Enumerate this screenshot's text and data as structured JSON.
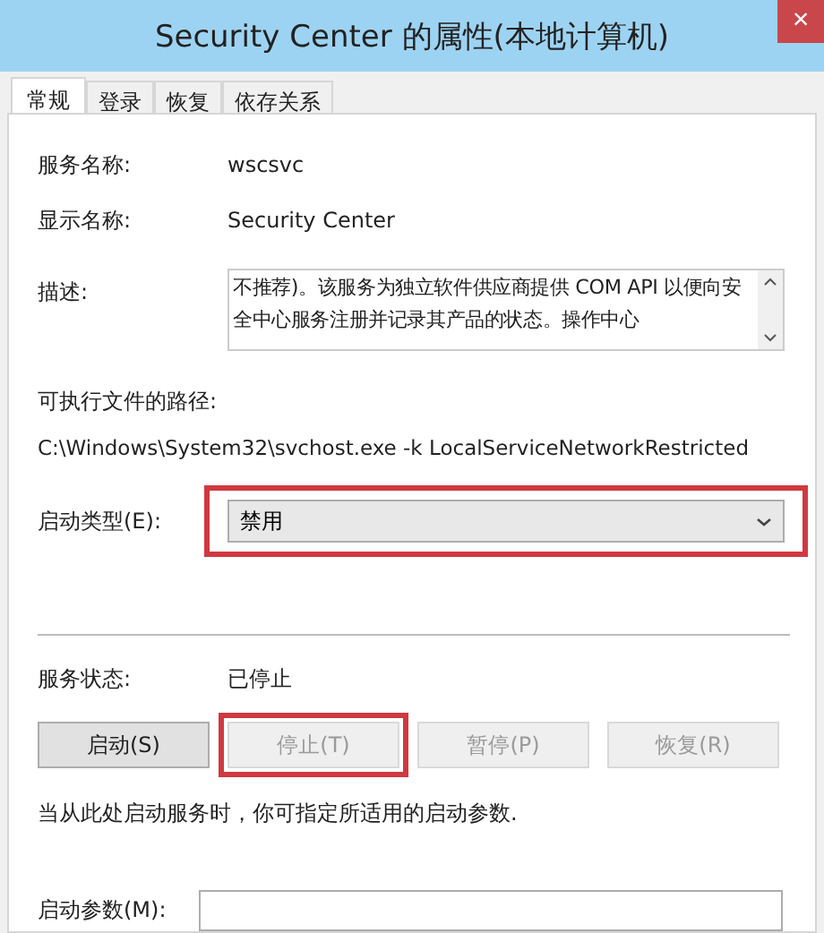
{
  "window": {
    "title": "Security Center 的属性(本地计算机)",
    "close": "×"
  },
  "tabs": [
    {
      "label": "常规",
      "selected": true
    },
    {
      "label": "登录",
      "selected": false
    },
    {
      "label": "恢复",
      "selected": false
    },
    {
      "label": "依存关系",
      "selected": false
    }
  ],
  "fields": [
    {
      "kind": "text",
      "label": "服务名称:",
      "value": "wscsvc"
    },
    {
      "kind": "text",
      "label": "显示名称:",
      "value": "Security Center"
    },
    {
      "kind": "textarea",
      "label": "描述:",
      "value": "不推荐)。该服务为独立软件供应商提供 COM API 以便向安全中心服务注册并记录其产品的状态。操作中心"
    }
  ],
  "path": {
    "label": "可执行文件的路径:",
    "value": "C:\\Windows\\System32\\svchost.exe -k LocalServiceNetworkRestricted"
  },
  "startup_type": {
    "label": "启动类型(E):",
    "value": "禁用",
    "highlighted": true
  },
  "service_status": {
    "label": "服务状态:",
    "value": "已停止"
  },
  "buttons": [
    {
      "label": "启动(S)",
      "disabled": false,
      "highlighted": false
    },
    {
      "label": "停止(T)",
      "disabled": true,
      "highlighted": true
    },
    {
      "label": "暂停(P)",
      "disabled": true,
      "highlighted": false
    },
    {
      "label": "恢复(R)",
      "disabled": true,
      "highlighted": false
    }
  ],
  "note": "当从此处启动服务时，你可指定所适用的启动参数.",
  "start_params": {
    "label": "启动参数(M):"
  }
}
